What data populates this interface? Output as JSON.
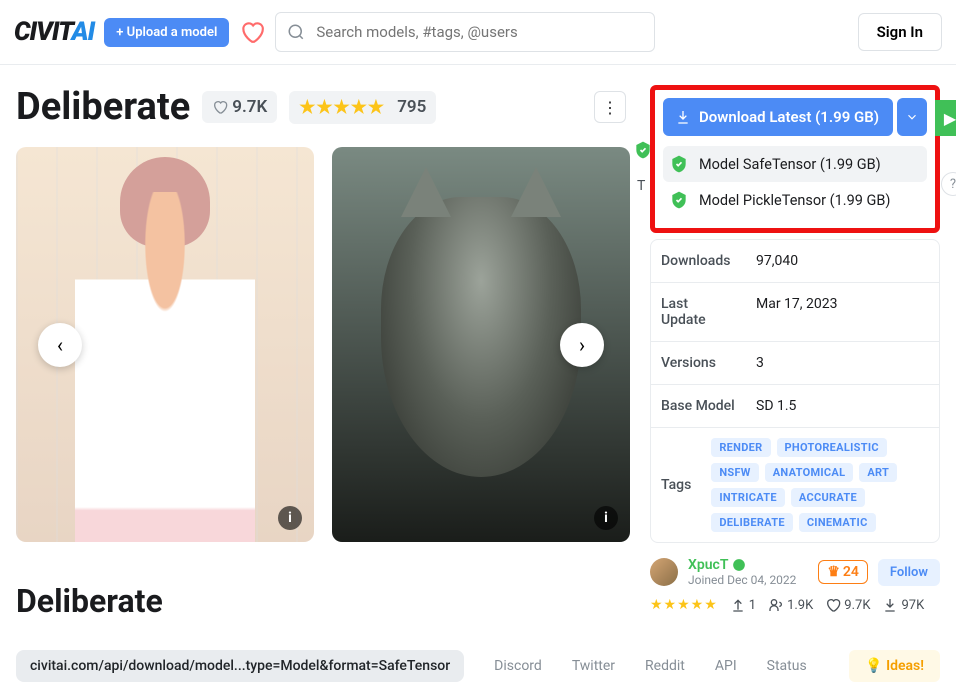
{
  "header": {
    "logo_main": "CIVIT",
    "logo_accent": "AI",
    "upload": "Upload a model",
    "search_placeholder": "Search models, #tags, @users",
    "signin": "Sign In"
  },
  "model": {
    "title": "Deliberate",
    "likes": "9.7K",
    "rating_count": "795"
  },
  "download": {
    "main": "Download Latest (1.99 GB)",
    "opt1": "Model SafeTensor (1.99 GB)",
    "opt2": "Model PickleTensor (1.99 GB)"
  },
  "details": {
    "downloads_k": "Downloads",
    "downloads_v": "97,040",
    "lastupdate_k": "Last Update",
    "lastupdate_v": "Mar 17, 2023",
    "versions_k": "Versions",
    "versions_v": "3",
    "basemodel_k": "Base Model",
    "basemodel_v": "SD 1.5",
    "tags_k": "Tags",
    "tags": [
      "RENDER",
      "PHOTOREALISTIC",
      "NSFW",
      "ANATOMICAL",
      "ART",
      "INTRICATE",
      "ACCURATE",
      "DELIBERATE",
      "CINEMATIC"
    ]
  },
  "author": {
    "name": "XpucT",
    "joined": "Joined Dec 04, 2022",
    "crown": "24",
    "follow": "Follow"
  },
  "stats": {
    "uploads": "1",
    "followers": "1.9K",
    "likes": "9.7K",
    "dl": "97K"
  },
  "section_title": "Deliberate",
  "footer": {
    "url": "civitai.com/api/download/model...type=Model&format=SafeTensor",
    "links": [
      "Discord",
      "Twitter",
      "Reddit",
      "API",
      "Status"
    ],
    "ideas": "Ideas!"
  }
}
